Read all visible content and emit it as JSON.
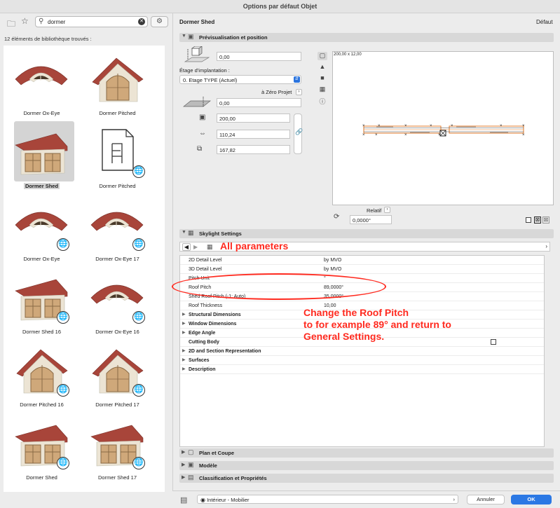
{
  "window": {
    "title": "Options par défaut Objet"
  },
  "library": {
    "search_value": "dormer",
    "count_text": "12 éléments de bibliothèque trouvés :",
    "items": [
      {
        "label": "Dormer Ox-Eye",
        "type": "oxeye",
        "globe": false
      },
      {
        "label": "Dormer Pitched",
        "type": "pitched",
        "globe": false
      },
      {
        "label": "Dormer Shed",
        "type": "shed",
        "globe": false,
        "selected": true
      },
      {
        "label": "Dormer Pitched",
        "type": "doc",
        "globe": true
      },
      {
        "label": "Dormer Ox-Eye",
        "type": "oxeye",
        "globe": true
      },
      {
        "label": "Dormer Ox-Eye 17",
        "type": "oxeye",
        "globe": true
      },
      {
        "label": "Dormer Shed 16",
        "type": "shed",
        "globe": true
      },
      {
        "label": "Dormer Ox-Eye 16",
        "type": "oxeye",
        "globe": true
      },
      {
        "label": "Dormer Pitched 16",
        "type": "pitched",
        "globe": true
      },
      {
        "label": "Dormer Pitched 17",
        "type": "pitched",
        "globe": true
      },
      {
        "label": "Dormer Shed",
        "type": "shed",
        "globe": true
      },
      {
        "label": "Dormer Shed 17",
        "type": "shed",
        "globe": true
      }
    ]
  },
  "header": {
    "object_name": "Dormer Shed",
    "default_label": "Défaut"
  },
  "sections": {
    "preview": "Prévisualisation et position",
    "skylight": "Skylight Settings",
    "plan": "Plan et Coupe",
    "model": "Modèle",
    "classification": "Classification et Propriétés"
  },
  "position": {
    "elevation": "0,00",
    "floor_label": "Étage d'implantation :",
    "floor_value": "0. Etage TYPE (Actuel)",
    "zero_label": "à Zéro Projet",
    "offset": "0,00",
    "dim_a": "200,00",
    "dim_b": "110,24",
    "dim_c": "167,82",
    "preview_size": "200,00 x 12,00",
    "relatif_label": "Relatif",
    "angle": "0,0000°"
  },
  "params": {
    "nav_label": "All parameters",
    "rows": [
      {
        "name": "2D Detail Level",
        "value": "by MVO",
        "group": false
      },
      {
        "name": "3D Detail Level",
        "value": "by MVO",
        "group": false
      },
      {
        "name": "Pitch Unit",
        "value": "°",
        "group": false
      },
      {
        "name": "Roof Pitch",
        "value": "89,0000°",
        "group": false
      },
      {
        "name": "Shed Roof Pitch (-1: Auto)",
        "value": "35,0000°",
        "group": false
      },
      {
        "name": "Roof Thickness",
        "value": "10,00",
        "group": false
      },
      {
        "name": "Structural Dimensions",
        "value": "",
        "group": true
      },
      {
        "name": "Window Dimensions",
        "value": "",
        "group": true
      },
      {
        "name": "Edge Angle",
        "value": "",
        "group": true
      },
      {
        "name": "Cutting Body",
        "value": "",
        "group": false,
        "checkbox": true
      },
      {
        "name": "2D and Section Representation",
        "value": "",
        "group": true
      },
      {
        "name": "Surfaces",
        "value": "",
        "group": true
      },
      {
        "name": "Description",
        "value": "",
        "group": true
      }
    ]
  },
  "annotation": {
    "line1": "Change the Roof Pitch",
    "line2": "to for example 89° and return to",
    "line3": "General Settings."
  },
  "footer": {
    "layer": "Intérieur - Mobilier",
    "cancel": "Annuler",
    "ok": "OK"
  },
  "colors": {
    "accent": "#2b78e4",
    "annotation": "#ff2a1f",
    "roof": "#a8453a",
    "wall": "#ece4d4"
  }
}
